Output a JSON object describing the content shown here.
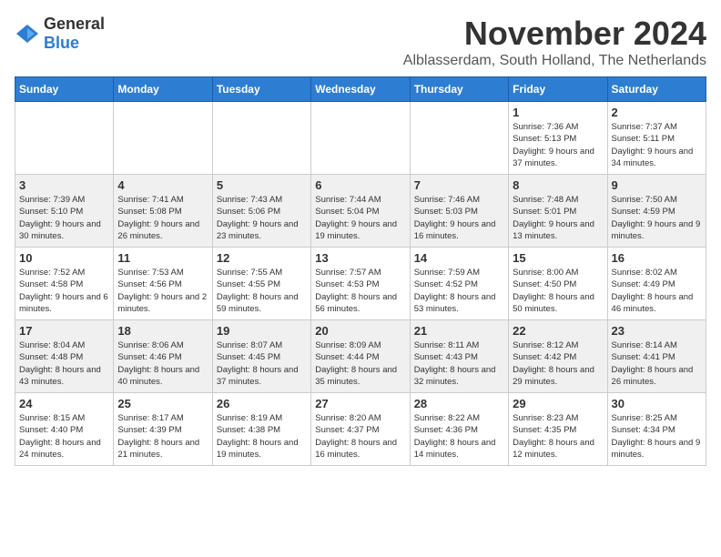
{
  "header": {
    "logo_general": "General",
    "logo_blue": "Blue",
    "month_title": "November 2024",
    "location": "Alblasserdam, South Holland, The Netherlands"
  },
  "weekdays": [
    "Sunday",
    "Monday",
    "Tuesday",
    "Wednesday",
    "Thursday",
    "Friday",
    "Saturday"
  ],
  "weeks": [
    [
      {
        "day": "",
        "detail": ""
      },
      {
        "day": "",
        "detail": ""
      },
      {
        "day": "",
        "detail": ""
      },
      {
        "day": "",
        "detail": ""
      },
      {
        "day": "",
        "detail": ""
      },
      {
        "day": "1",
        "detail": "Sunrise: 7:36 AM\nSunset: 5:13 PM\nDaylight: 9 hours and 37 minutes."
      },
      {
        "day": "2",
        "detail": "Sunrise: 7:37 AM\nSunset: 5:11 PM\nDaylight: 9 hours and 34 minutes."
      }
    ],
    [
      {
        "day": "3",
        "detail": "Sunrise: 7:39 AM\nSunset: 5:10 PM\nDaylight: 9 hours and 30 minutes."
      },
      {
        "day": "4",
        "detail": "Sunrise: 7:41 AM\nSunset: 5:08 PM\nDaylight: 9 hours and 26 minutes."
      },
      {
        "day": "5",
        "detail": "Sunrise: 7:43 AM\nSunset: 5:06 PM\nDaylight: 9 hours and 23 minutes."
      },
      {
        "day": "6",
        "detail": "Sunrise: 7:44 AM\nSunset: 5:04 PM\nDaylight: 9 hours and 19 minutes."
      },
      {
        "day": "7",
        "detail": "Sunrise: 7:46 AM\nSunset: 5:03 PM\nDaylight: 9 hours and 16 minutes."
      },
      {
        "day": "8",
        "detail": "Sunrise: 7:48 AM\nSunset: 5:01 PM\nDaylight: 9 hours and 13 minutes."
      },
      {
        "day": "9",
        "detail": "Sunrise: 7:50 AM\nSunset: 4:59 PM\nDaylight: 9 hours and 9 minutes."
      }
    ],
    [
      {
        "day": "10",
        "detail": "Sunrise: 7:52 AM\nSunset: 4:58 PM\nDaylight: 9 hours and 6 minutes."
      },
      {
        "day": "11",
        "detail": "Sunrise: 7:53 AM\nSunset: 4:56 PM\nDaylight: 9 hours and 2 minutes."
      },
      {
        "day": "12",
        "detail": "Sunrise: 7:55 AM\nSunset: 4:55 PM\nDaylight: 8 hours and 59 minutes."
      },
      {
        "day": "13",
        "detail": "Sunrise: 7:57 AM\nSunset: 4:53 PM\nDaylight: 8 hours and 56 minutes."
      },
      {
        "day": "14",
        "detail": "Sunrise: 7:59 AM\nSunset: 4:52 PM\nDaylight: 8 hours and 53 minutes."
      },
      {
        "day": "15",
        "detail": "Sunrise: 8:00 AM\nSunset: 4:50 PM\nDaylight: 8 hours and 50 minutes."
      },
      {
        "day": "16",
        "detail": "Sunrise: 8:02 AM\nSunset: 4:49 PM\nDaylight: 8 hours and 46 minutes."
      }
    ],
    [
      {
        "day": "17",
        "detail": "Sunrise: 8:04 AM\nSunset: 4:48 PM\nDaylight: 8 hours and 43 minutes."
      },
      {
        "day": "18",
        "detail": "Sunrise: 8:06 AM\nSunset: 4:46 PM\nDaylight: 8 hours and 40 minutes."
      },
      {
        "day": "19",
        "detail": "Sunrise: 8:07 AM\nSunset: 4:45 PM\nDaylight: 8 hours and 37 minutes."
      },
      {
        "day": "20",
        "detail": "Sunrise: 8:09 AM\nSunset: 4:44 PM\nDaylight: 8 hours and 35 minutes."
      },
      {
        "day": "21",
        "detail": "Sunrise: 8:11 AM\nSunset: 4:43 PM\nDaylight: 8 hours and 32 minutes."
      },
      {
        "day": "22",
        "detail": "Sunrise: 8:12 AM\nSunset: 4:42 PM\nDaylight: 8 hours and 29 minutes."
      },
      {
        "day": "23",
        "detail": "Sunrise: 8:14 AM\nSunset: 4:41 PM\nDaylight: 8 hours and 26 minutes."
      }
    ],
    [
      {
        "day": "24",
        "detail": "Sunrise: 8:15 AM\nSunset: 4:40 PM\nDaylight: 8 hours and 24 minutes."
      },
      {
        "day": "25",
        "detail": "Sunrise: 8:17 AM\nSunset: 4:39 PM\nDaylight: 8 hours and 21 minutes."
      },
      {
        "day": "26",
        "detail": "Sunrise: 8:19 AM\nSunset: 4:38 PM\nDaylight: 8 hours and 19 minutes."
      },
      {
        "day": "27",
        "detail": "Sunrise: 8:20 AM\nSunset: 4:37 PM\nDaylight: 8 hours and 16 minutes."
      },
      {
        "day": "28",
        "detail": "Sunrise: 8:22 AM\nSunset: 4:36 PM\nDaylight: 8 hours and 14 minutes."
      },
      {
        "day": "29",
        "detail": "Sunrise: 8:23 AM\nSunset: 4:35 PM\nDaylight: 8 hours and 12 minutes."
      },
      {
        "day": "30",
        "detail": "Sunrise: 8:25 AM\nSunset: 4:34 PM\nDaylight: 8 hours and 9 minutes."
      }
    ]
  ]
}
